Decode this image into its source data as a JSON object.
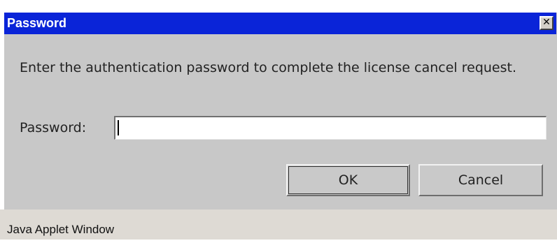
{
  "window": {
    "title": "Password",
    "close_glyph": "✕",
    "close_icon": "close-icon"
  },
  "dialog": {
    "message": "Enter the authentication password to complete the license cancel request.",
    "password_label": "Password:",
    "password_value": "",
    "ok_label": "OK",
    "cancel_label": "Cancel"
  },
  "status_bar": {
    "text": "Java Applet Window"
  },
  "colors": {
    "titlebar": "#0a24d8",
    "dialog_bg": "#c8c8c8",
    "status_bg": "#dedad4"
  }
}
